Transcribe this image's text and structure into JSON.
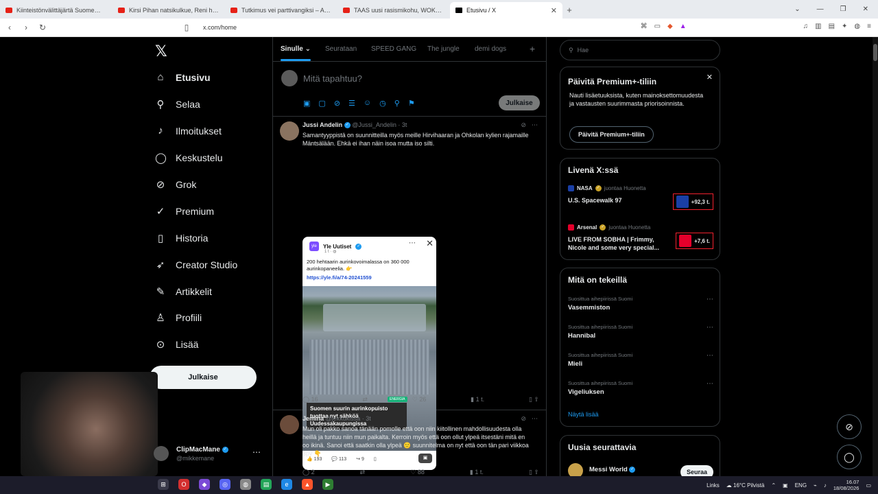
{
  "browser": {
    "tabs": [
      {
        "label": "Kiinteistönvälittäjärtä Suomen suosit..."
      },
      {
        "label": "Kirsi Pihan natsikulkue, Reni heitetti..."
      },
      {
        "label": "Tutkimus vei parttivangiksi – Atte Ka..."
      },
      {
        "label": "TAAS uusi rasismikohu, WOKE-p..."
      },
      {
        "label": "Etusivu / X"
      }
    ],
    "url": "x.com/home"
  },
  "sidebar": {
    "items": [
      {
        "label": "Etusivu",
        "icon": "home-icon"
      },
      {
        "label": "Selaa",
        "icon": "search-icon"
      },
      {
        "label": "Ilmoitukset",
        "icon": "bell-icon"
      },
      {
        "label": "Keskustelu",
        "icon": "chat-icon"
      },
      {
        "label": "Grok",
        "icon": "grok-icon"
      },
      {
        "label": "Premium",
        "icon": "premium-icon"
      },
      {
        "label": "Historia",
        "icon": "bookmark-icon"
      },
      {
        "label": "Creator Studio",
        "icon": "rocket-icon"
      },
      {
        "label": "Artikkelit",
        "icon": "article-icon"
      },
      {
        "label": "Profiili",
        "icon": "person-icon"
      },
      {
        "label": "Lisää",
        "icon": "more-icon"
      }
    ],
    "post_label": "Julkaise",
    "account": {
      "name": "ClipMacMane",
      "handle": "@mikkemane"
    }
  },
  "feed": {
    "tabs": [
      "Sinulle",
      "Seurataan",
      "SPEED GANG",
      "The jungle",
      "demi dogs"
    ],
    "compose_placeholder": "Mitä tapahtuu?",
    "compose_post": "Julkaise",
    "tweets": [
      {
        "name": "Jussi Andelin",
        "handle": "@Jussi_Andelin · 3t",
        "text": "Samantyyppistä on suunnitteilla myös meille Hirvihaaran ja Ohkolan kylien rajamaille Mäntsälään. Ehkä ei ihan näin isoa mutta iso silti.",
        "embed": {
          "source": "Yle Uutiset",
          "time": "1 t · ◍",
          "text": "200 hehtaarin aurinkovoimalassa on 360 000 aurinkopaneelia. 👉",
          "link": "https://yle.fi/a/74-20241559",
          "tag": "ENERGIA",
          "caption": "Suomen suurin aurinkopuisto tuottaa nyt sähköä Uudessakaupungissa",
          "likes": "193",
          "comments": "113",
          "shares": "9"
        },
        "replies": "16",
        "likes": "26",
        "views": "1 t."
      },
      {
        "name": "Jemina",
        "handle": "@jekkukissa · 3t",
        "text": "Mun oli pakko sanoa tänään pomolle että oon niin kiitollinen mahdollisuudesta olla heillä ja tuntuu niin mun paikalta. Kerroin myös että oon ollut ylpeä itsestäni mitä en oo ikinä. Sanoi että saatkin olla ylpeä 🙂 suunnitelma on nyt että oon tän pari viikkoa 3pv 👇",
        "replies": "2",
        "likes": "88",
        "views": "1 t."
      }
    ]
  },
  "right": {
    "search_placeholder": "Hae",
    "premium": {
      "title": "Päivitä Premium+-tiliin",
      "desc": "Nauti lisäetuuksista, kuten mainoksettomuudesta ja vastausten suurimmasta priorisoinnista.",
      "button": "Päivitä Premium+-tiliin"
    },
    "live": {
      "title": "Livenä X:ssä",
      "items": [
        {
          "host": "NASA",
          "meta": "juontaa Huonetta",
          "title": "U.S. Spacewalk 97",
          "count": "+92,3 t."
        },
        {
          "host": "Arsenal",
          "meta": "juontaa Huonetta",
          "title": "LIVE FROM SOBHA | Frimmy, Nicole and some very special...",
          "count": "+7,6 t."
        }
      ]
    },
    "trends": {
      "title": "Mitä on tekeillä",
      "items": [
        {
          "context": "Suosittua aihepiirissä Suomi",
          "name": "Vasemmiston"
        },
        {
          "context": "Suosittua aihepiirissä Suomi",
          "name": "Hannibal"
        },
        {
          "context": "Suosittua aihepiirissä Suomi",
          "name": "Mieli"
        },
        {
          "context": "Suosittua aihepiirissä Suomi",
          "name": "Vigeliuksen"
        }
      ],
      "show_more": "Näytä lisää"
    },
    "follow": {
      "title": "Uusia seurattavia",
      "name": "Messi World",
      "button": "Seuraa"
    }
  },
  "taskbar": {
    "links": "Links",
    "weather": "16°C Pilvistä",
    "lang": "ENG",
    "time": "16.07",
    "date": "18/08/2026"
  }
}
